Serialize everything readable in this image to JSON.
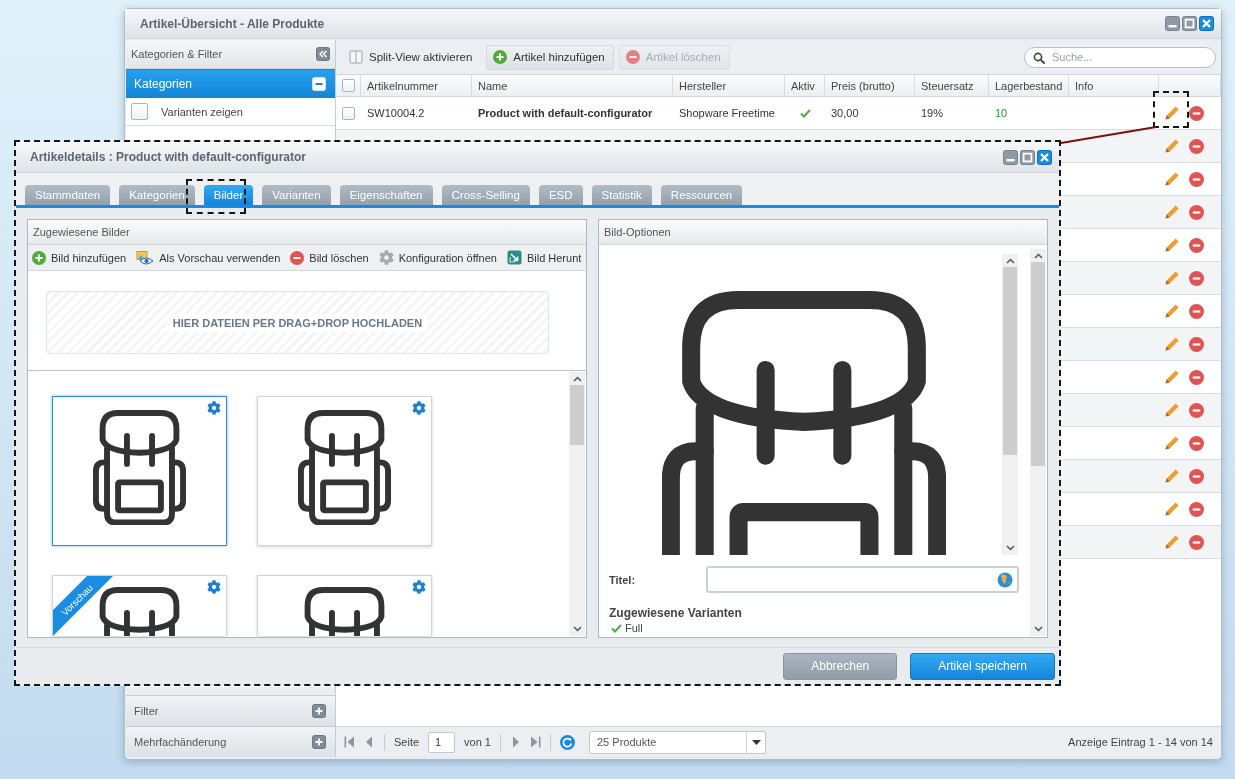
{
  "main_window": {
    "title": "Artikel-Übersicht - Alle Produkte"
  },
  "sidebar": {
    "title": "Kategorien & Filter",
    "sections": [
      {
        "label": "Kategorien",
        "expanded": true,
        "options": [
          {
            "label": "Varianten zeigen",
            "checked": false
          }
        ]
      },
      {
        "label": "Filter",
        "expanded": false
      },
      {
        "label": "Mehrfachänderung",
        "expanded": false
      }
    ]
  },
  "toolbar": {
    "buttons": [
      {
        "kind": "split",
        "label": "Split-View aktivieren",
        "disabled": false
      },
      {
        "kind": "add",
        "label": "Artikel hinzufügen",
        "disabled": false
      },
      {
        "kind": "delete",
        "label": "Artikel löschen",
        "disabled": true
      }
    ],
    "search": {
      "placeholder": "Suche..."
    }
  },
  "table": {
    "select_all": {
      "checked": false
    },
    "columns": [
      "Artikelnummer",
      "Name",
      "Hersteller",
      "Aktiv",
      "Preis (brutto)",
      "Steuersatz",
      "Lagerbestand",
      "Info"
    ],
    "rows": [
      {
        "kind": "full",
        "checked": false,
        "number": "SW10004.2",
        "name": "Product with default-configurator",
        "manufacturer": "Shopware Freetime",
        "active": true,
        "price": "30,00",
        "tax": "19%",
        "stock": "10"
      },
      {
        "kind": "covered"
      },
      {
        "kind": "covered"
      },
      {
        "kind": "covered"
      },
      {
        "kind": "covered"
      },
      {
        "kind": "covered"
      },
      {
        "kind": "covered"
      },
      {
        "kind": "covered"
      },
      {
        "kind": "covered"
      },
      {
        "kind": "covered"
      },
      {
        "kind": "covered"
      },
      {
        "kind": "covered"
      },
      {
        "kind": "covered"
      },
      {
        "kind": "covered"
      }
    ]
  },
  "pagination": {
    "page_label": "Seite",
    "page": "1",
    "page_count": "von 1",
    "page_size": "25 Produkte",
    "summary": "Anzeige Eintrag 1 - 14 von 14"
  },
  "detail_window": {
    "title": "Artikeldetails : Product with default-configurator",
    "tabs": [
      {
        "label": "Stammdaten",
        "selected": false
      },
      {
        "label": "Kategorien",
        "selected": false
      },
      {
        "label": "Bilder",
        "selected": true
      },
      {
        "label": "Varianten",
        "selected": false
      },
      {
        "label": "Eigenschaften",
        "selected": false
      },
      {
        "label": "Cross-Selling",
        "selected": false
      },
      {
        "label": "ESD",
        "selected": false
      },
      {
        "label": "Statistik",
        "selected": false
      },
      {
        "label": "Ressourcen",
        "selected": false
      }
    ],
    "images_panel": {
      "title": "Zugewiesene Bilder",
      "actions": [
        {
          "kind": "add",
          "label": "Bild hinzufügen"
        },
        {
          "kind": "preview",
          "label": "Als Vorschau verwenden"
        },
        {
          "kind": "delete",
          "label": "Bild löschen"
        },
        {
          "kind": "config",
          "label": "Konfiguration öffnen"
        },
        {
          "kind": "download",
          "label": "Bild Herunt"
        }
      ],
      "dropzone": "HIER DATEIEN PER DRAG+DROP HOCHLADEN",
      "images": [
        {
          "selected": true
        },
        {
          "selected": false
        },
        {
          "selected": false,
          "badge": "Vorschau"
        },
        {
          "selected": false
        }
      ]
    },
    "options_panel": {
      "title": "Bild-Optionen",
      "title_field": {
        "label": "Titel:"
      },
      "variants": {
        "heading": "Zugewiesene Varianten",
        "items": [
          {
            "label": "Full",
            "checked": true
          }
        ]
      }
    },
    "buttons": [
      {
        "kind": "cancel",
        "label": "Abbrechen"
      },
      {
        "kind": "primary",
        "label": "Artikel speichern"
      }
    ]
  }
}
